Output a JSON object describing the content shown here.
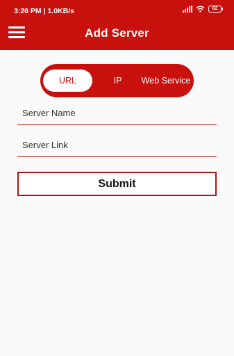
{
  "status_bar": {
    "time_speed": "3:26 PM | 1.0KB/s",
    "battery": "62",
    "signal_icon": "signal-bars-icon",
    "wifi_icon": "wifi-icon"
  },
  "app_bar": {
    "menu_icon": "hamburger-menu-icon",
    "title": "Add Server",
    "color": "#c8100c"
  },
  "server_type_tabs": {
    "selected": "URL",
    "tabs": [
      {
        "label": "URL",
        "active": true
      },
      {
        "label": "IP",
        "active": false
      },
      {
        "label": "Web Service",
        "active": false
      }
    ]
  },
  "form": {
    "server_name": {
      "placeholder": "Server Name",
      "value": ""
    },
    "server_link": {
      "placeholder": "Server Link",
      "value": ""
    },
    "submit_label": "Submit"
  }
}
